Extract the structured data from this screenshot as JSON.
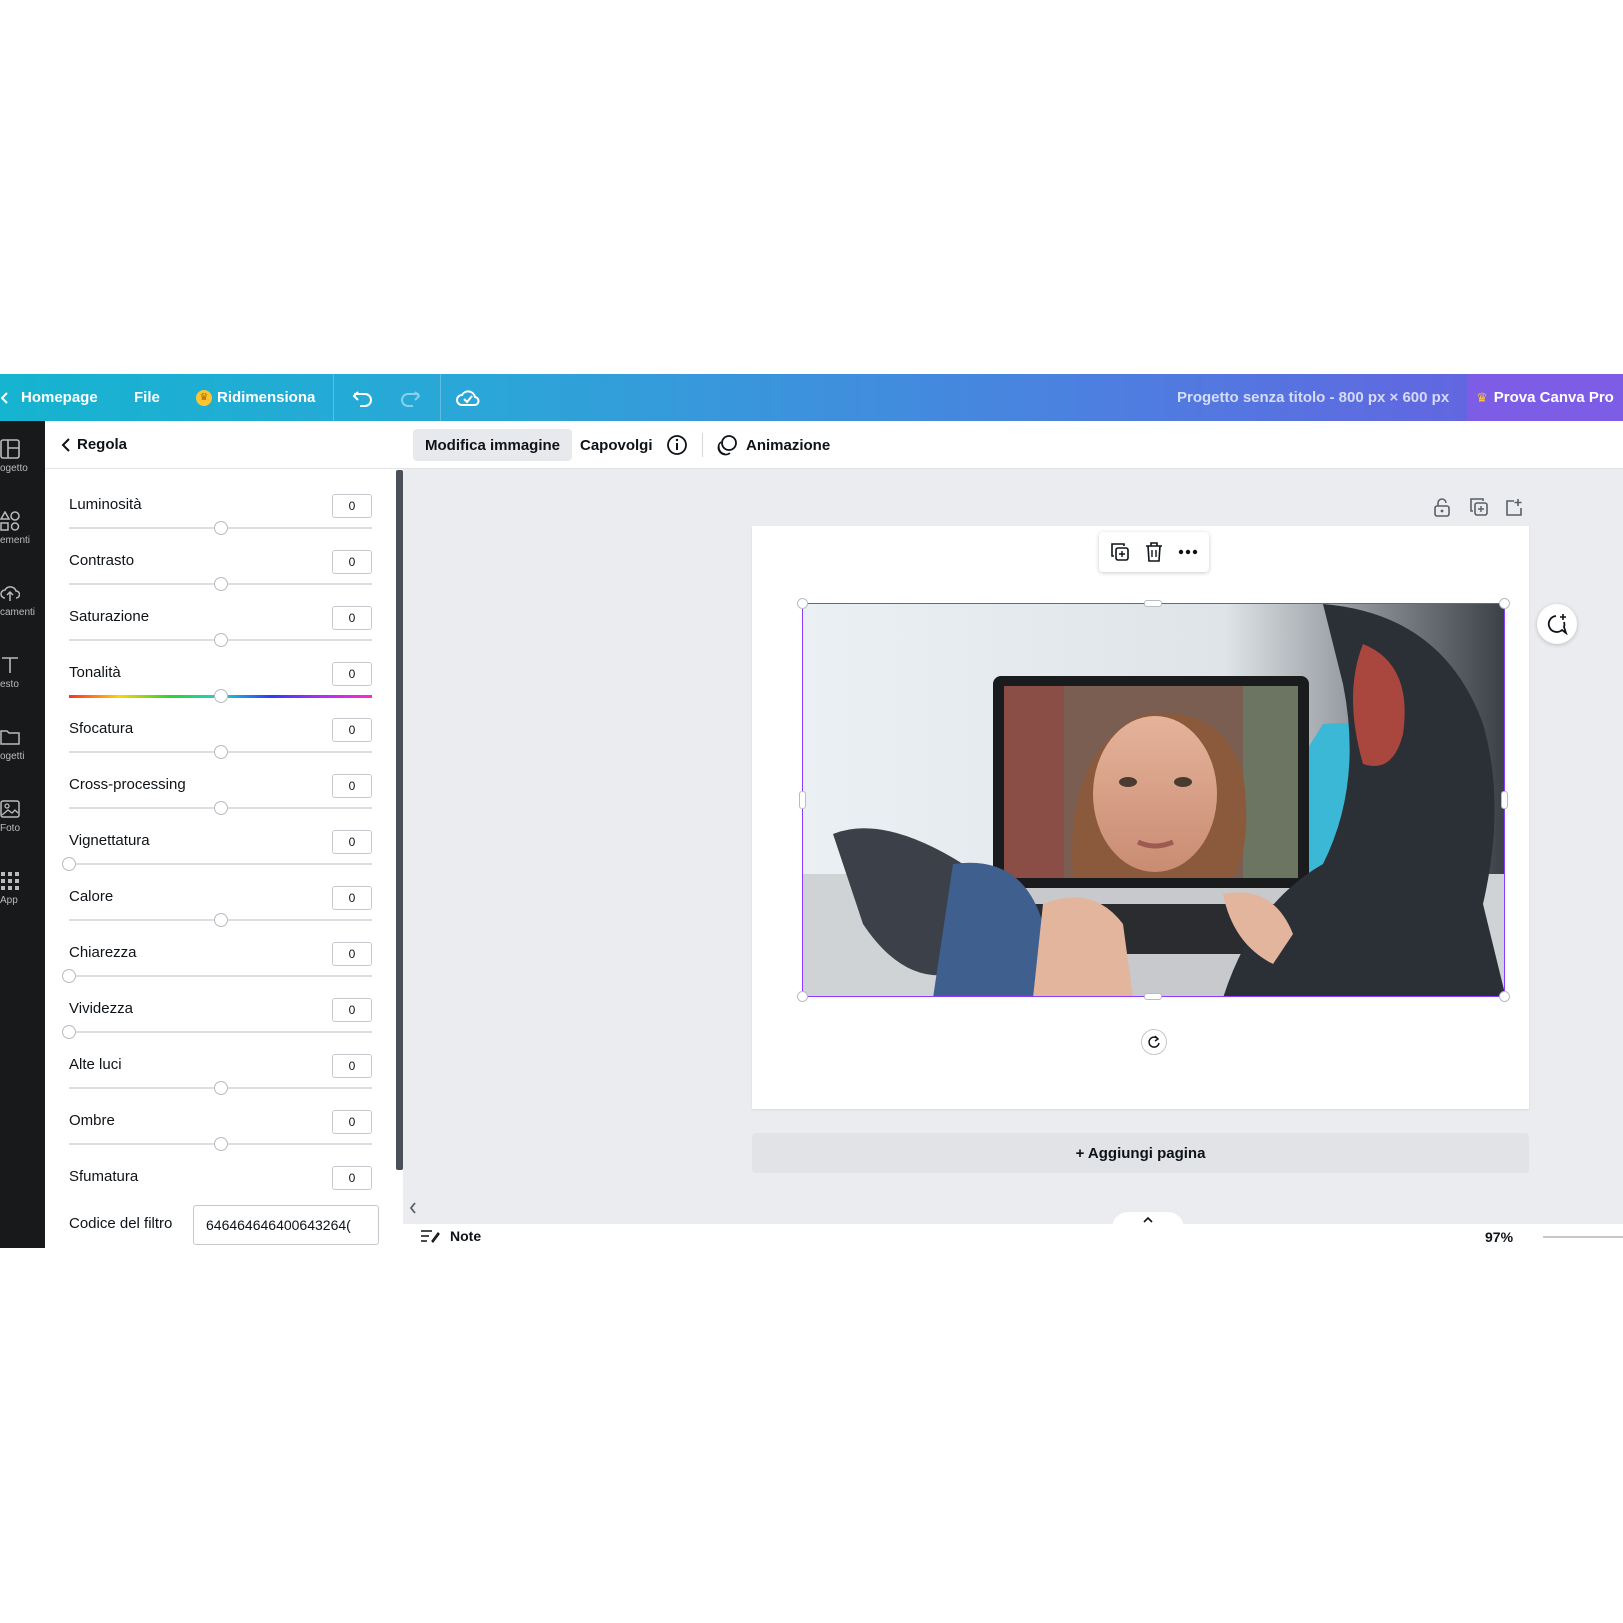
{
  "topbar": {
    "back_arrow": "chevron-left-icon",
    "home": "Homepage",
    "file": "File",
    "resize": "Ridimensiona",
    "project_title": "Progetto senza titolo - 800 px × 600 px",
    "pro": "Prova Canva Pro"
  },
  "rail": [
    {
      "label": "ogetto",
      "icon": "layout-icon"
    },
    {
      "label": "ementi",
      "icon": "elements-icon"
    },
    {
      "label": "camenti",
      "icon": "upload-cloud-icon"
    },
    {
      "label": "esto",
      "icon": "text-icon"
    },
    {
      "label": "ogetti",
      "icon": "folder-icon"
    },
    {
      "label": "Foto",
      "icon": "photo-icon"
    },
    {
      "label": "App",
      "icon": "apps-grid-icon"
    }
  ],
  "panel": {
    "title": "Regola",
    "adjustments": [
      {
        "label": "Luminosità",
        "value": "0",
        "level": 0.5,
        "hue": false
      },
      {
        "label": "Contrasto",
        "value": "0",
        "level": 0.5,
        "hue": false
      },
      {
        "label": "Saturazione",
        "value": "0",
        "level": 0.5,
        "hue": false
      },
      {
        "label": "Tonalità",
        "value": "0",
        "level": 0.5,
        "hue": true
      },
      {
        "label": "Sfocatura",
        "value": "0",
        "level": 0.5,
        "hue": false
      },
      {
        "label": "Cross-processing",
        "value": "0",
        "level": 0.5,
        "hue": false
      },
      {
        "label": "Vignettatura",
        "value": "0",
        "level": 0,
        "hue": false
      },
      {
        "label": "Calore",
        "value": "0",
        "level": 0.5,
        "hue": false
      },
      {
        "label": "Chiarezza",
        "value": "0",
        "level": 0,
        "hue": false
      },
      {
        "label": "Vividezza",
        "value": "0",
        "level": 0,
        "hue": false
      },
      {
        "label": "Alte luci",
        "value": "0",
        "level": 0.5,
        "hue": false
      },
      {
        "label": "Ombre",
        "value": "0",
        "level": 0.5,
        "hue": false
      },
      {
        "label": "Sfumatura",
        "value": "0",
        "level": null,
        "hue": false
      }
    ],
    "filter_label": "Codice del filtro",
    "filter_code": "646464646400643264("
  },
  "toolbar": {
    "edit_image": "Modifica immagine",
    "flip": "Capovolgi",
    "animation": "Animazione"
  },
  "canvas": {
    "add_page": "+ Aggiungi pagina"
  },
  "footer": {
    "notes": "Note",
    "zoom": "97%"
  }
}
